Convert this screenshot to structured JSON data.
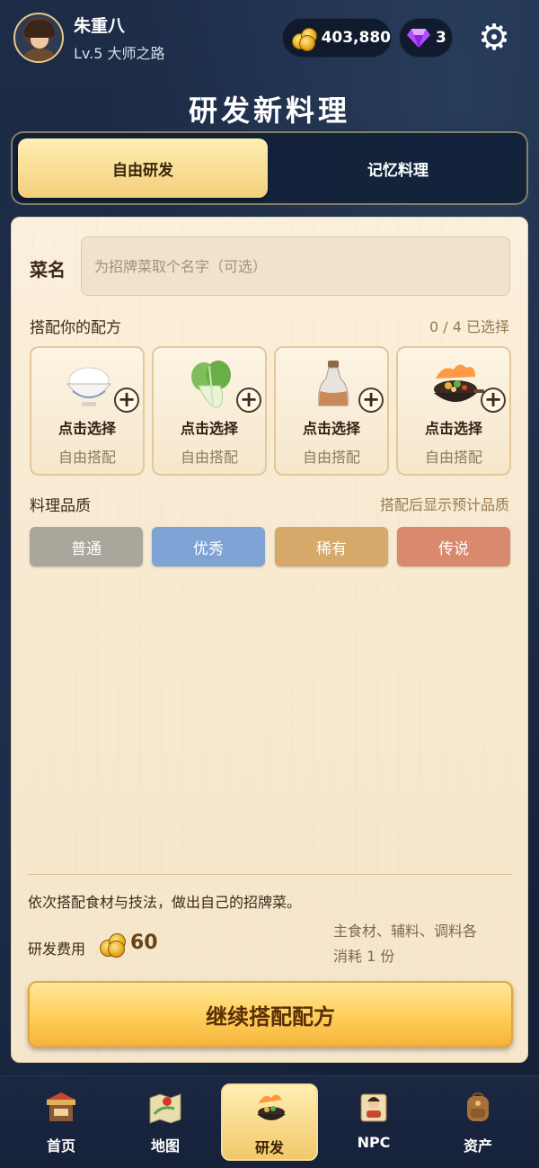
{
  "player": {
    "name": "朱重八",
    "level": "Lv.5 大师之路"
  },
  "currency": {
    "gold": "403,880",
    "gems": "3"
  },
  "page_title": "研发新料理",
  "tabs": [
    {
      "label": "自由研发",
      "active": true
    },
    {
      "label": "记忆料理",
      "active": false
    }
  ],
  "dish_name": {
    "label": "菜名",
    "placeholder": "为招牌菜取个名字（可选）",
    "value": ""
  },
  "recipe": {
    "label": "搭配你的配方",
    "selected_count": "0 / 4 已选择",
    "slots": [
      {
        "icon": "rice-bowl-icon",
        "action": "点击选择",
        "hint": "自由搭配"
      },
      {
        "icon": "bok-choy-icon",
        "action": "点击选择",
        "hint": "自由搭配"
      },
      {
        "icon": "sauce-bottle-icon",
        "action": "点击选择",
        "hint": "自由搭配"
      },
      {
        "icon": "wok-stirfry-icon",
        "action": "点击选择",
        "hint": "自由搭配"
      }
    ]
  },
  "quality": {
    "label": "料理品质",
    "hint": "搭配后显示预计品质",
    "levels": [
      {
        "label": "普通",
        "color": "#a9a69c"
      },
      {
        "label": "优秀",
        "color": "#7ea3d4"
      },
      {
        "label": "稀有",
        "color": "#d6a869"
      },
      {
        "label": "传说",
        "color": "#d98a6e"
      }
    ]
  },
  "footer": {
    "description": "依次搭配食材与技法，做出自己的招牌菜。",
    "cost_label": "研发费用",
    "cost_value": "60",
    "cost_note_1": "主食材、辅料、调料各",
    "cost_note_2": "消耗 1 份",
    "button": "继续搭配配方"
  },
  "nav": [
    {
      "label": "首页",
      "icon": "shop-stall-icon",
      "active": false
    },
    {
      "label": "地图",
      "icon": "map-icon",
      "active": false
    },
    {
      "label": "研发",
      "icon": "wok-icon",
      "active": true
    },
    {
      "label": "NPC",
      "icon": "npc-scroll-icon",
      "active": false
    },
    {
      "label": "资产",
      "icon": "backpack-icon",
      "active": false
    }
  ]
}
